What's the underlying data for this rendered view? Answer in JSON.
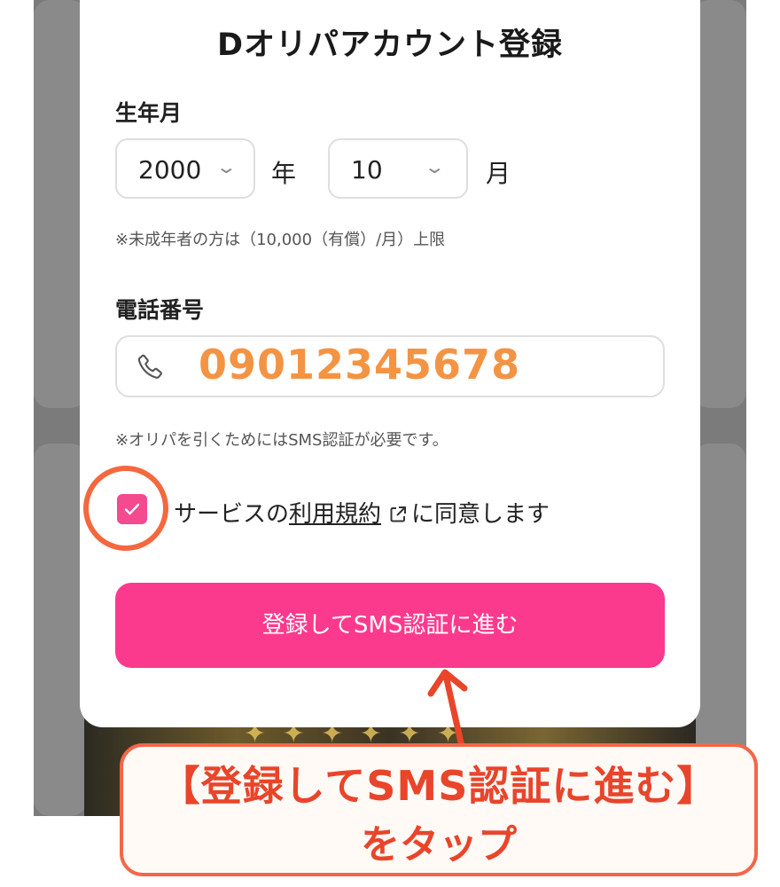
{
  "modal": {
    "title": "Dオリパアカウント登録",
    "birth_label": "生年月",
    "year_value": "2000",
    "year_unit": "年",
    "month_value": "10",
    "month_unit": "月",
    "minor_note": "※未成年者の方は（10,000（有償）/月）上限",
    "phone_label": "電話番号",
    "phone_value": "09012345678",
    "sms_note": "※オリパを引くためにはSMS認証が必要です。",
    "agree_prefix": "サービスの",
    "terms_link": "利用規約",
    "agree_suffix": "に同意します",
    "submit_label": "登録してSMS認証に進む",
    "checkbox_checked": true
  },
  "callout": {
    "line1": "【登録してSMS認証に進む】",
    "line2": "をタップ"
  },
  "colors": {
    "accent_pink": "#fc3a8d",
    "phone_orange": "#f39444",
    "annotation_red": "#e8452b"
  },
  "icons": [
    "chevron-down-icon",
    "phone-icon",
    "checkmark-icon",
    "external-link-icon",
    "arrow-up-icon"
  ]
}
